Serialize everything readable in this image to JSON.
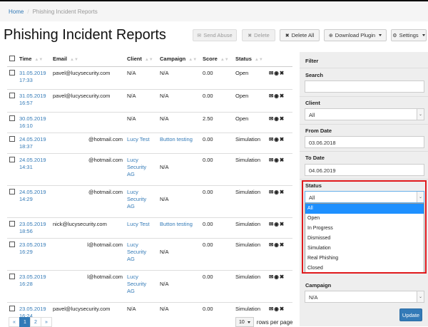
{
  "breadcrumb": {
    "home": "Home",
    "current": "Phishing Incident Reports"
  },
  "page_title": "Phishing Incident Reports",
  "toolbar": {
    "send_abuse": "Send Abuse",
    "delete": "Delete",
    "delete_all": "Delete All",
    "download_plugin": "Download Plugin",
    "settings": "Settings"
  },
  "table": {
    "headers": [
      "Time",
      "Email",
      "Client",
      "Campaign",
      "Score",
      "Status"
    ],
    "rows": [
      {
        "time": [
          "31.05.2019",
          "17:33"
        ],
        "email": "pavel@lucysecurity.com",
        "client": [
          "N/A"
        ],
        "client_link": false,
        "campaign": "N/A",
        "campaign_link": false,
        "score": "0.00",
        "status": "Open"
      },
      {
        "time": [
          "31.05.2019",
          "16:57"
        ],
        "email": "pavel@lucysecurity.com",
        "client": [
          "N/A"
        ],
        "client_link": false,
        "campaign": "N/A",
        "campaign_link": false,
        "score": "0.00",
        "status": "Open"
      },
      {
        "time": [
          "30.05.2019",
          "16:10"
        ],
        "email": "",
        "client": [
          "N/A"
        ],
        "client_link": false,
        "campaign": "N/A",
        "campaign_link": false,
        "score": "2.50",
        "status": "Open"
      },
      {
        "time": [
          "24.05.2019",
          "18:37"
        ],
        "email": "@hotmail.com",
        "client": [
          "Lucy Test"
        ],
        "client_link": true,
        "campaign": "Button testing",
        "campaign_link": true,
        "score": "0.00",
        "status": "Simulation"
      },
      {
        "time": [
          "24.05.2019",
          "14:31"
        ],
        "email": "@hotmail.com",
        "client": [
          "Lucy",
          "Security",
          "AG"
        ],
        "client_link": true,
        "campaign": "N/A",
        "campaign_link": false,
        "score": "0.00",
        "status": "Simulation"
      },
      {
        "time": [
          "24.05.2019",
          "14:29"
        ],
        "email": "@hotmail.com",
        "client": [
          "Lucy",
          "Security",
          "AG"
        ],
        "client_link": true,
        "campaign": "N/A",
        "campaign_link": false,
        "score": "0.00",
        "status": "Simulation"
      },
      {
        "time": [
          "23.05.2019",
          "18:56"
        ],
        "email": "nick@lucysecurity.com",
        "client": [
          "Lucy Test"
        ],
        "client_link": true,
        "campaign": "Button testing",
        "campaign_link": true,
        "score": "0.00",
        "status": "Simulation"
      },
      {
        "time": [
          "23.05.2019",
          "16:29"
        ],
        "email": "l@hotmail.com",
        "client": [
          "Lucy",
          "Security",
          "AG"
        ],
        "client_link": true,
        "campaign": "N/A",
        "campaign_link": false,
        "score": "0.00",
        "status": "Simulation"
      },
      {
        "time": [
          "23.05.2019",
          "16:28"
        ],
        "email": "l@hotmail.com",
        "client": [
          "Lucy",
          "Security",
          "AG"
        ],
        "client_link": true,
        "campaign": "N/A",
        "campaign_link": false,
        "score": "0.00",
        "status": "Simulation"
      },
      {
        "time": [
          "23.05.2019",
          "16:24"
        ],
        "email": "pavel@lucysecurity.com",
        "client": [
          "N/A"
        ],
        "client_link": false,
        "campaign": "N/A",
        "campaign_link": false,
        "score": "0.00",
        "status": "Simulation"
      }
    ]
  },
  "pagination": {
    "prev": "«",
    "pages": [
      "1",
      "2"
    ],
    "next": "»",
    "current": "1"
  },
  "rows_per_page": {
    "value": "10",
    "label": "rows per page"
  },
  "filter": {
    "title": "Filter",
    "search_label": "Search",
    "search_value": "",
    "client_label": "Client",
    "client_value": "All",
    "from_label": "From Date",
    "from_value": "03.06.2018",
    "to_label": "To Date",
    "to_value": "04.06.2019",
    "status_label": "Status",
    "status_value": "All",
    "status_options": [
      "All",
      "Open",
      "In Progress",
      "Dismissed",
      "Simulation",
      "Real Phishing",
      "Closed"
    ],
    "campaign_label": "Campaign",
    "campaign_value": "N/A",
    "update": "Update"
  },
  "colors": {
    "link": "#337ab7",
    "highlight": "#e0191c",
    "selected_option": "#1e90ff"
  }
}
